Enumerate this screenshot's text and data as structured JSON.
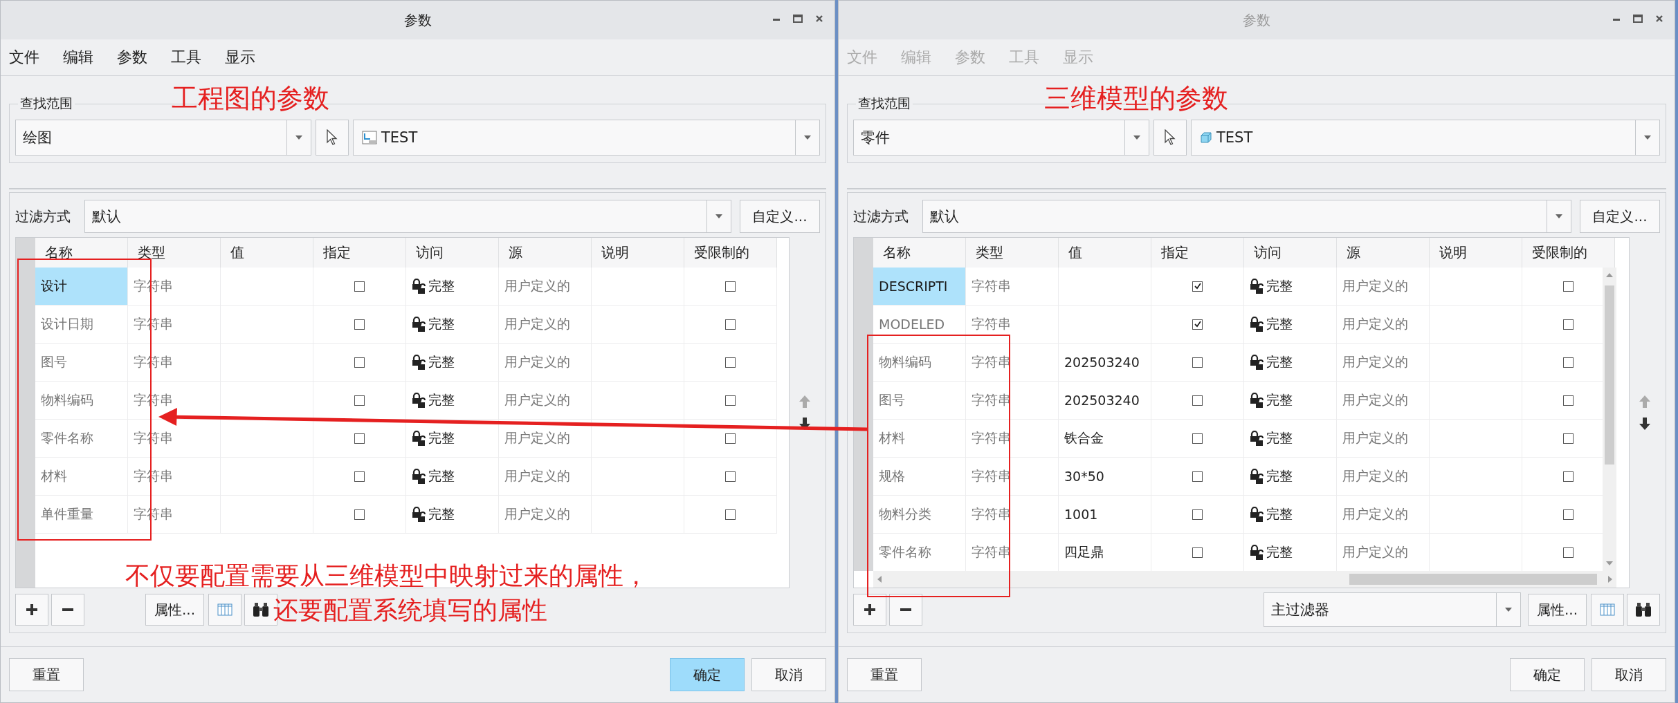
{
  "windows": [
    {
      "title": "参数",
      "active": true,
      "menu": [
        {
          "label": "文件",
          "disabled": false
        },
        {
          "label": "编辑",
          "disabled": false
        },
        {
          "label": "参数",
          "disabled": false
        },
        {
          "label": "工具",
          "disabled": false
        },
        {
          "label": "显示",
          "disabled": false
        }
      ],
      "annotation": "工程图的参数",
      "scope": {
        "label": "查找范围",
        "type": "绘图",
        "model": "TEST",
        "kind": "drawing"
      },
      "filter": {
        "label": "过滤方式",
        "value": "默认",
        "button": "自定义..."
      },
      "columns": [
        "名称",
        "类型",
        "值",
        "指定",
        "访问",
        "源",
        "说明",
        "受限制的"
      ],
      "rows": [
        {
          "name": "设计",
          "type": "字符串",
          "value": "",
          "designated": false,
          "access": "完整",
          "source": "用户定义的",
          "restricted": false,
          "selected": true
        },
        {
          "name": "设计日期",
          "type": "字符串",
          "value": "",
          "designated": false,
          "access": "完整",
          "source": "用户定义的",
          "restricted": false,
          "selected": false
        },
        {
          "name": "图号",
          "type": "字符串",
          "value": "",
          "designated": false,
          "access": "完整",
          "source": "用户定义的",
          "restricted": false,
          "selected": false
        },
        {
          "name": "物料编码",
          "type": "字符串",
          "value": "",
          "designated": false,
          "access": "完整",
          "source": "用户定义的",
          "restricted": false,
          "selected": false
        },
        {
          "name": "零件名称",
          "type": "字符串",
          "value": "",
          "designated": false,
          "access": "完整",
          "source": "用户定义的",
          "restricted": false,
          "selected": false
        },
        {
          "name": "材料",
          "type": "字符串",
          "value": "",
          "designated": false,
          "access": "完整",
          "source": "用户定义的",
          "restricted": false,
          "selected": false
        },
        {
          "name": "单件重量",
          "type": "字符串",
          "value": "",
          "designated": false,
          "access": "完整",
          "source": "用户定义的",
          "restricted": false,
          "selected": false
        }
      ],
      "scrollbars": false,
      "note": [
        "不仅要配置需要从三维模型中映射过来的属性，",
        "还要配置系统填写的属性"
      ],
      "toolbar": {
        "properties": "属性..."
      },
      "footer": {
        "reset": "重置",
        "ok": "确定",
        "cancel": "取消",
        "ok_default": true
      }
    },
    {
      "title": "参数",
      "active": false,
      "menu": [
        {
          "label": "文件",
          "disabled": true
        },
        {
          "label": "编辑",
          "disabled": true
        },
        {
          "label": "参数",
          "disabled": true
        },
        {
          "label": "工具",
          "disabled": true
        },
        {
          "label": "显示",
          "disabled": true
        }
      ],
      "annotation": "三维模型的参数",
      "scope": {
        "label": "查找范围",
        "type": "零件",
        "model": "TEST",
        "kind": "part"
      },
      "filter": {
        "label": "过滤方式",
        "value": "默认",
        "button": "自定义..."
      },
      "columns": [
        "名称",
        "类型",
        "值",
        "指定",
        "访问",
        "源",
        "说明",
        "受限制的"
      ],
      "rows": [
        {
          "name": "DESCRIPTI",
          "type": "字符串",
          "value": "",
          "designated": true,
          "access": "完整",
          "source": "用户定义的",
          "restricted": false,
          "selected": true
        },
        {
          "name": "MODELED",
          "type": "字符串",
          "value": "",
          "designated": true,
          "access": "完整",
          "source": "用户定义的",
          "restricted": false,
          "selected": false
        },
        {
          "name": "物料编码",
          "type": "字符串",
          "value": "202503240",
          "designated": false,
          "access": "完整",
          "source": "用户定义的",
          "restricted": false,
          "selected": false
        },
        {
          "name": "图号",
          "type": "字符串",
          "value": "202503240",
          "designated": false,
          "access": "完整",
          "source": "用户定义的",
          "restricted": false,
          "selected": false
        },
        {
          "name": "材料",
          "type": "字符串",
          "value": "铁合金",
          "designated": false,
          "access": "完整",
          "source": "用户定义的",
          "restricted": false,
          "selected": false
        },
        {
          "name": "规格",
          "type": "字符串",
          "value": "30*50",
          "designated": false,
          "access": "完整",
          "source": "用户定义的",
          "restricted": false,
          "selected": false
        },
        {
          "name": "物料分类",
          "type": "字符串",
          "value": "1001",
          "designated": false,
          "access": "完整",
          "source": "用户定义的",
          "restricted": false,
          "selected": false
        },
        {
          "name": "零件名称",
          "type": "字符串",
          "value": "四足鼎",
          "designated": false,
          "access": "完整",
          "source": "用户定义的",
          "restricted": false,
          "selected": false
        }
      ],
      "scrollbars": true,
      "toolbar": {
        "filter": "主过滤器",
        "properties": "属性..."
      },
      "footer": {
        "reset": "重置",
        "ok": "确定",
        "cancel": "取消",
        "ok_default": false
      }
    }
  ]
}
